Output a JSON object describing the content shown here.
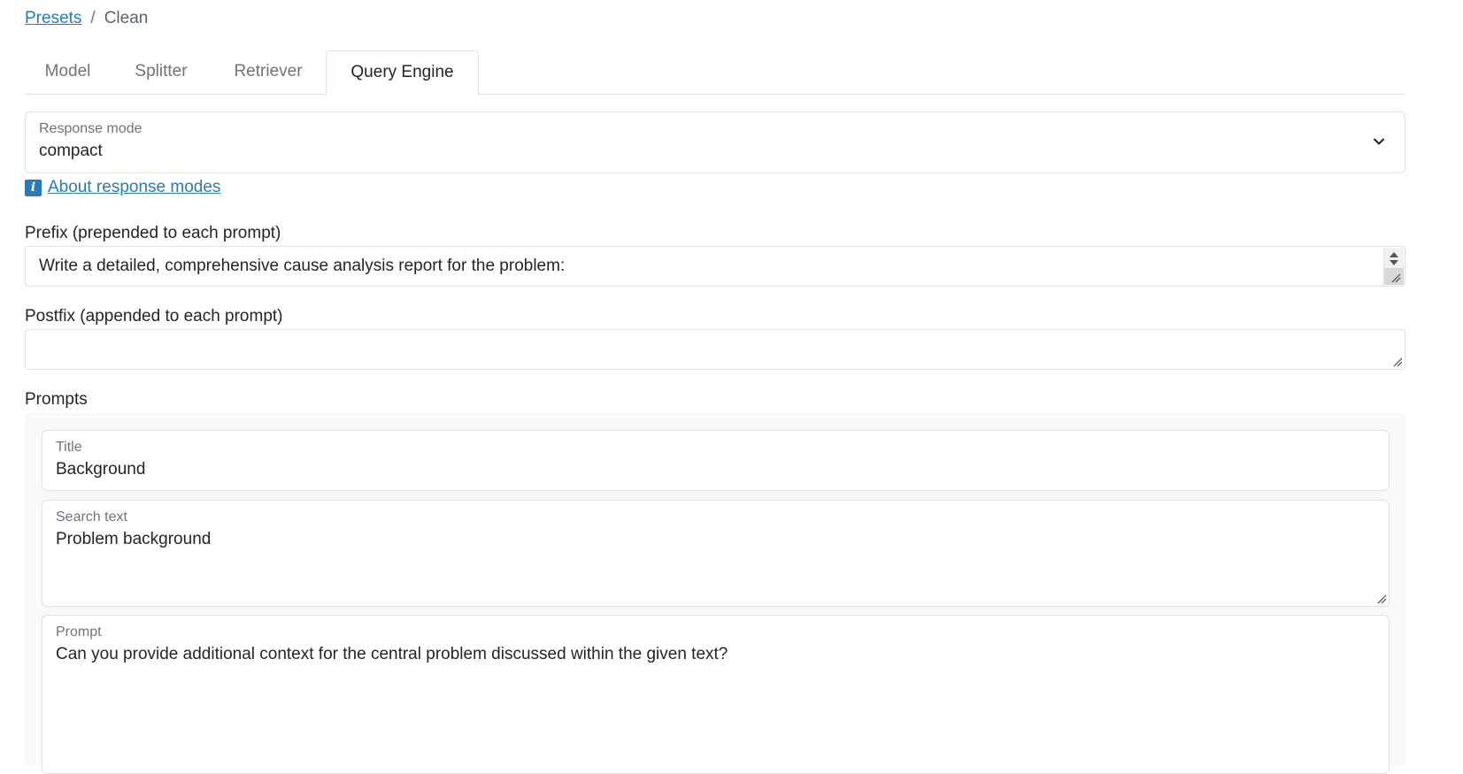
{
  "breadcrumb": {
    "link": "Presets",
    "separator": "/",
    "current": "Clean"
  },
  "tabs": [
    {
      "label": "Model",
      "active": false
    },
    {
      "label": "Splitter",
      "active": false
    },
    {
      "label": "Retriever",
      "active": false
    },
    {
      "label": "Query Engine",
      "active": true
    }
  ],
  "response_mode": {
    "label": "Response mode",
    "value": "compact"
  },
  "info": {
    "icon": "info-icon",
    "glyph": "i",
    "link": "About response modes"
  },
  "prefix": {
    "label": "Prefix (prepended to each prompt)",
    "value": "Write a detailed, comprehensive cause analysis report for the problem:"
  },
  "postfix": {
    "label": "Postfix (appended to each prompt)",
    "value": ""
  },
  "prompts": {
    "label": "Prompts",
    "items": [
      {
        "title_label": "Title",
        "title_value": "Background",
        "search_label": "Search text",
        "search_value": "Problem background",
        "prompt_label": "Prompt",
        "prompt_value": "Can you provide additional context for the central problem discussed within the given text?"
      }
    ]
  },
  "colors": {
    "link": "#2a7ab8",
    "border": "#dee2e6",
    "panel": "#f8f9fa"
  }
}
